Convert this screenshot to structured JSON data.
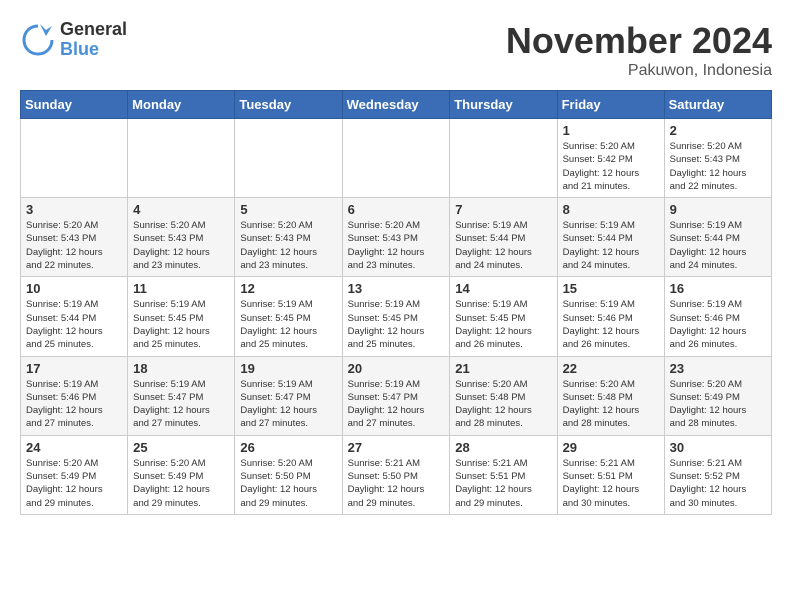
{
  "logo": {
    "line1": "General",
    "line2": "Blue"
  },
  "title": "November 2024",
  "location": "Pakuwon, Indonesia",
  "weekdays": [
    "Sunday",
    "Monday",
    "Tuesday",
    "Wednesday",
    "Thursday",
    "Friday",
    "Saturday"
  ],
  "weeks": [
    [
      {
        "day": "",
        "info": ""
      },
      {
        "day": "",
        "info": ""
      },
      {
        "day": "",
        "info": ""
      },
      {
        "day": "",
        "info": ""
      },
      {
        "day": "",
        "info": ""
      },
      {
        "day": "1",
        "info": "Sunrise: 5:20 AM\nSunset: 5:42 PM\nDaylight: 12 hours\nand 21 minutes."
      },
      {
        "day": "2",
        "info": "Sunrise: 5:20 AM\nSunset: 5:43 PM\nDaylight: 12 hours\nand 22 minutes."
      }
    ],
    [
      {
        "day": "3",
        "info": "Sunrise: 5:20 AM\nSunset: 5:43 PM\nDaylight: 12 hours\nand 22 minutes."
      },
      {
        "day": "4",
        "info": "Sunrise: 5:20 AM\nSunset: 5:43 PM\nDaylight: 12 hours\nand 23 minutes."
      },
      {
        "day": "5",
        "info": "Sunrise: 5:20 AM\nSunset: 5:43 PM\nDaylight: 12 hours\nand 23 minutes."
      },
      {
        "day": "6",
        "info": "Sunrise: 5:20 AM\nSunset: 5:43 PM\nDaylight: 12 hours\nand 23 minutes."
      },
      {
        "day": "7",
        "info": "Sunrise: 5:19 AM\nSunset: 5:44 PM\nDaylight: 12 hours\nand 24 minutes."
      },
      {
        "day": "8",
        "info": "Sunrise: 5:19 AM\nSunset: 5:44 PM\nDaylight: 12 hours\nand 24 minutes."
      },
      {
        "day": "9",
        "info": "Sunrise: 5:19 AM\nSunset: 5:44 PM\nDaylight: 12 hours\nand 24 minutes."
      }
    ],
    [
      {
        "day": "10",
        "info": "Sunrise: 5:19 AM\nSunset: 5:44 PM\nDaylight: 12 hours\nand 25 minutes."
      },
      {
        "day": "11",
        "info": "Sunrise: 5:19 AM\nSunset: 5:45 PM\nDaylight: 12 hours\nand 25 minutes."
      },
      {
        "day": "12",
        "info": "Sunrise: 5:19 AM\nSunset: 5:45 PM\nDaylight: 12 hours\nand 25 minutes."
      },
      {
        "day": "13",
        "info": "Sunrise: 5:19 AM\nSunset: 5:45 PM\nDaylight: 12 hours\nand 25 minutes."
      },
      {
        "day": "14",
        "info": "Sunrise: 5:19 AM\nSunset: 5:45 PM\nDaylight: 12 hours\nand 26 minutes."
      },
      {
        "day": "15",
        "info": "Sunrise: 5:19 AM\nSunset: 5:46 PM\nDaylight: 12 hours\nand 26 minutes."
      },
      {
        "day": "16",
        "info": "Sunrise: 5:19 AM\nSunset: 5:46 PM\nDaylight: 12 hours\nand 26 minutes."
      }
    ],
    [
      {
        "day": "17",
        "info": "Sunrise: 5:19 AM\nSunset: 5:46 PM\nDaylight: 12 hours\nand 27 minutes."
      },
      {
        "day": "18",
        "info": "Sunrise: 5:19 AM\nSunset: 5:47 PM\nDaylight: 12 hours\nand 27 minutes."
      },
      {
        "day": "19",
        "info": "Sunrise: 5:19 AM\nSunset: 5:47 PM\nDaylight: 12 hours\nand 27 minutes."
      },
      {
        "day": "20",
        "info": "Sunrise: 5:19 AM\nSunset: 5:47 PM\nDaylight: 12 hours\nand 27 minutes."
      },
      {
        "day": "21",
        "info": "Sunrise: 5:20 AM\nSunset: 5:48 PM\nDaylight: 12 hours\nand 28 minutes."
      },
      {
        "day": "22",
        "info": "Sunrise: 5:20 AM\nSunset: 5:48 PM\nDaylight: 12 hours\nand 28 minutes."
      },
      {
        "day": "23",
        "info": "Sunrise: 5:20 AM\nSunset: 5:49 PM\nDaylight: 12 hours\nand 28 minutes."
      }
    ],
    [
      {
        "day": "24",
        "info": "Sunrise: 5:20 AM\nSunset: 5:49 PM\nDaylight: 12 hours\nand 29 minutes."
      },
      {
        "day": "25",
        "info": "Sunrise: 5:20 AM\nSunset: 5:49 PM\nDaylight: 12 hours\nand 29 minutes."
      },
      {
        "day": "26",
        "info": "Sunrise: 5:20 AM\nSunset: 5:50 PM\nDaylight: 12 hours\nand 29 minutes."
      },
      {
        "day": "27",
        "info": "Sunrise: 5:21 AM\nSunset: 5:50 PM\nDaylight: 12 hours\nand 29 minutes."
      },
      {
        "day": "28",
        "info": "Sunrise: 5:21 AM\nSunset: 5:51 PM\nDaylight: 12 hours\nand 29 minutes."
      },
      {
        "day": "29",
        "info": "Sunrise: 5:21 AM\nSunset: 5:51 PM\nDaylight: 12 hours\nand 30 minutes."
      },
      {
        "day": "30",
        "info": "Sunrise: 5:21 AM\nSunset: 5:52 PM\nDaylight: 12 hours\nand 30 minutes."
      }
    ]
  ]
}
